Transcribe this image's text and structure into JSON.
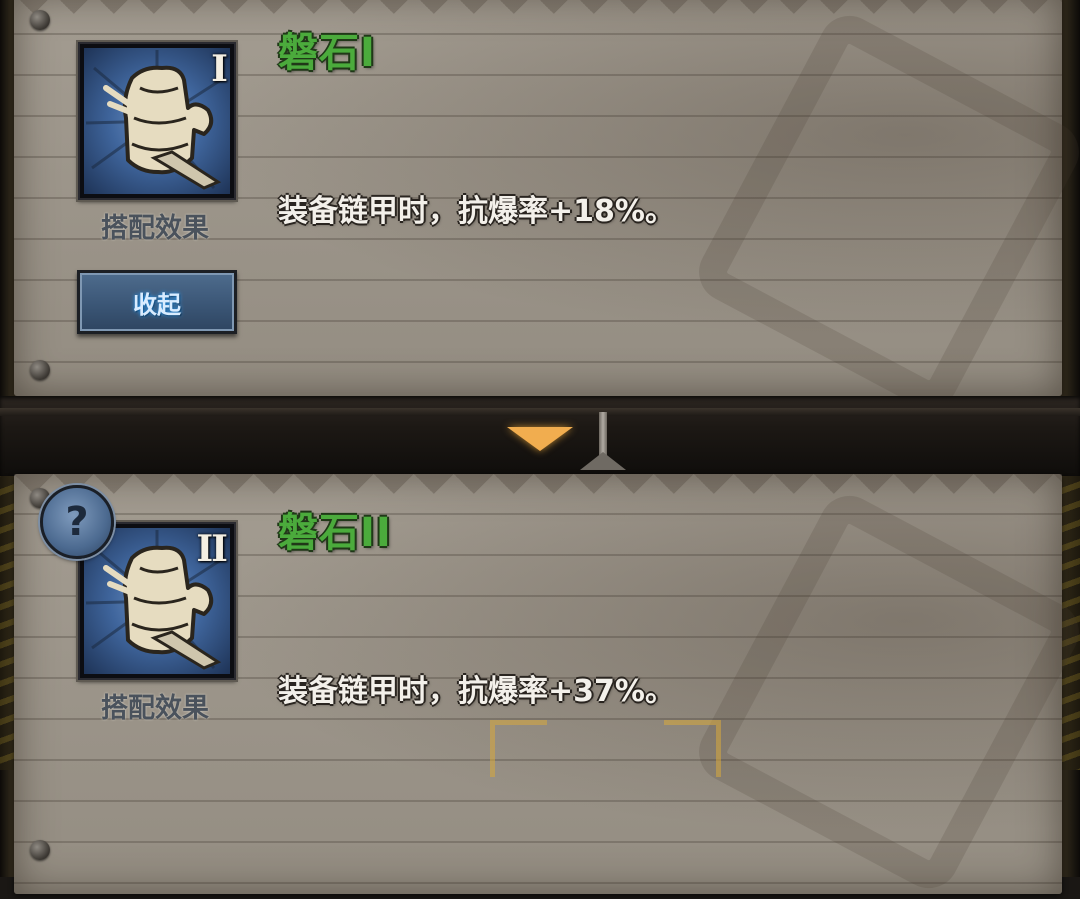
{
  "sets": [
    {
      "title": "磐石I",
      "tier_numeral": "I",
      "icon": "armor-chest-icon",
      "caption": "搭配效果",
      "description": "装备链甲时，抗爆率+18%。",
      "collapse_label": "收起"
    },
    {
      "title": "磐石II",
      "tier_numeral": "II",
      "icon": "armor-chest-icon",
      "caption": "搭配效果",
      "description": "装备链甲时，抗爆率+37%。",
      "help_icon_glyph": "?"
    }
  ],
  "colors": {
    "title_green": "#4bab3c",
    "description_text": "#f3f0ea",
    "parchment": "#9d968b",
    "button_blue": "#3b5676",
    "arrow_orange": "#f1ad4f"
  }
}
